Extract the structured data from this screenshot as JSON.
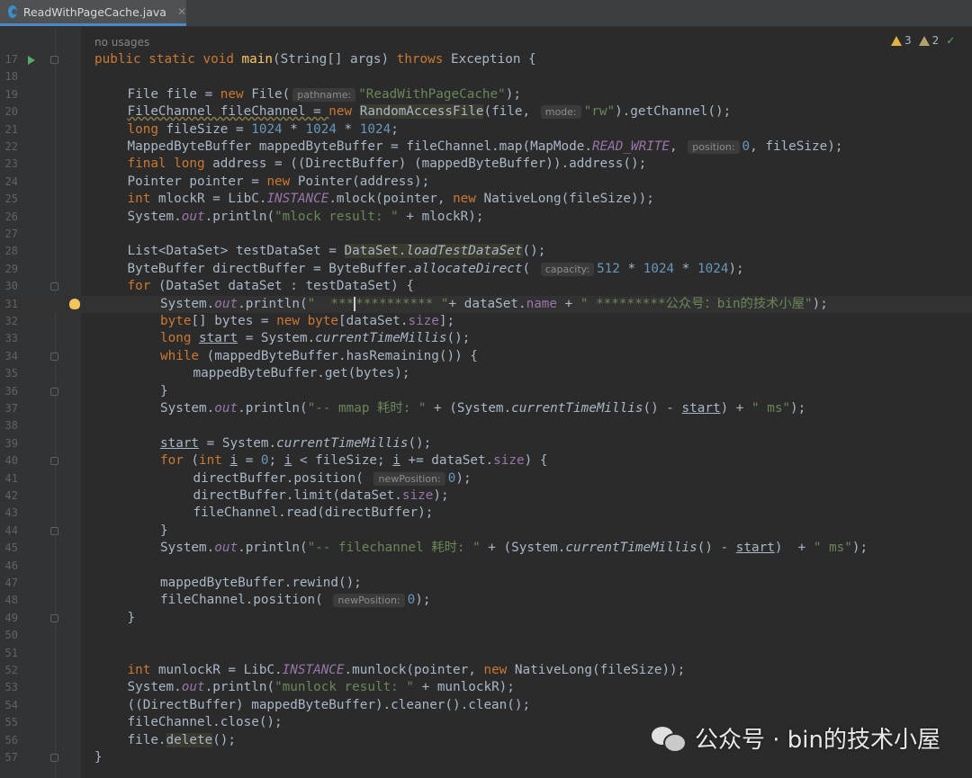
{
  "tab": {
    "filename": "ReadWithPageCache.java",
    "icon": "java-class-icon"
  },
  "no_usages": "no usages",
  "inspections": {
    "warnings": "3",
    "weak_warnings": "2",
    "ok_icon": "check-icon"
  },
  "lines": [
    {
      "n": "17"
    },
    {
      "n": "18"
    },
    {
      "n": "19"
    },
    {
      "n": "20"
    },
    {
      "n": "21"
    },
    {
      "n": "22"
    },
    {
      "n": "23"
    },
    {
      "n": "24"
    },
    {
      "n": "25"
    },
    {
      "n": "26"
    },
    {
      "n": "27"
    },
    {
      "n": "28"
    },
    {
      "n": "29"
    },
    {
      "n": "30"
    },
    {
      "n": "31"
    },
    {
      "n": "32"
    },
    {
      "n": "33"
    },
    {
      "n": "34"
    },
    {
      "n": "35"
    },
    {
      "n": "36"
    },
    {
      "n": "37"
    },
    {
      "n": "38"
    },
    {
      "n": "39"
    },
    {
      "n": "40"
    },
    {
      "n": "41"
    },
    {
      "n": "42"
    },
    {
      "n": "43"
    },
    {
      "n": "44"
    },
    {
      "n": "45"
    },
    {
      "n": "46"
    },
    {
      "n": "47"
    },
    {
      "n": "48"
    },
    {
      "n": "49"
    },
    {
      "n": "50"
    },
    {
      "n": "51"
    },
    {
      "n": "52"
    },
    {
      "n": "53"
    },
    {
      "n": "54"
    },
    {
      "n": "55"
    },
    {
      "n": "56"
    },
    {
      "n": "57"
    }
  ],
  "code": {
    "l17": [
      "public static void ",
      "main",
      "(String[] args) ",
      "throws",
      " Exception {"
    ],
    "l19": [
      "File file = ",
      "new",
      " File(",
      "pathname:",
      "\"ReadWithPageCache\"",
      ");"
    ],
    "l20": [
      "FileChannel fileChannel = ",
      "new",
      " ",
      "RandomAccessFile",
      "(file, ",
      "mode:",
      "\"rw\"",
      ").getChannel();"
    ],
    "l21": [
      "long",
      " fileSize = ",
      "1024",
      " * ",
      "1024",
      " * ",
      "1024",
      ";"
    ],
    "l22": [
      "MappedByteBuffer mappedByteBuffer = fileChannel.map(MapMode.",
      "READ_WRITE",
      ", ",
      "position:",
      "0",
      ", fileSize);"
    ],
    "l23": [
      "final long",
      " address = ((DirectBuffer) (mappedByteBuffer)).address();"
    ],
    "l24": [
      "Pointer pointer = ",
      "new",
      " Pointer(address);"
    ],
    "l25": [
      "int",
      " mlockR = LibC.",
      "INSTANCE",
      ".mlock(pointer, ",
      "new",
      " NativeLong(fileSize));"
    ],
    "l26": [
      "System.",
      "out",
      ".println(",
      "\"mlock result: \"",
      " + mlockR);"
    ],
    "l28": [
      "List<DataSet> testDataSet = ",
      "DataSet.",
      "loadTestDataSet",
      "();"
    ],
    "l29": [
      "ByteBuffer directBuffer = ByteBuffer.",
      "allocateDirect",
      "( ",
      "capacity:",
      "512",
      " * ",
      "1024",
      " * ",
      "1024",
      ");"
    ],
    "l30": [
      "for",
      " (DataSet dataSet : testDataSet) {"
    ],
    "l31": [
      "System.",
      "out",
      ".println(",
      "\"  ***",
      "**********",
      " \"",
      "+ dataSet.",
      "name",
      " + ",
      "\" *********公众号：bin的技术小屋\"",
      ");"
    ],
    "l32": [
      "byte",
      "[] bytes = ",
      "new",
      " ",
      "byte",
      "[dataSet.",
      "size",
      "];"
    ],
    "l33": [
      "long",
      " ",
      "start",
      " = System.",
      "currentTimeMillis",
      "();"
    ],
    "l34": [
      "while",
      " (mappedByteBuffer.hasRemaining()) {"
    ],
    "l35": [
      "mappedByteBuffer.get(bytes);"
    ],
    "l36": [
      "}"
    ],
    "l37": [
      "System.",
      "out",
      ".println(",
      "\"-- mmap 耗时: \"",
      " + (System.",
      "currentTimeMillis",
      "() - ",
      "start",
      ") + ",
      "\" ms\"",
      ");"
    ],
    "l39": [
      "start",
      " = System.",
      "currentTimeMillis",
      "();"
    ],
    "l40": [
      "for",
      " (",
      "int",
      " ",
      "i",
      " = ",
      "0",
      "; ",
      "i",
      " < fileSize; ",
      "i",
      " += dataSet.",
      "size",
      ") {"
    ],
    "l41": [
      "directBuffer.position( ",
      "newPosition:",
      "0",
      ");"
    ],
    "l42": [
      "directBuffer.limit(dataSet.",
      "size",
      ");"
    ],
    "l43": [
      "fileChannel.read(directBuffer);"
    ],
    "l44": [
      "}"
    ],
    "l45": [
      "System.",
      "out",
      ".println(",
      "\"-- filechannel 耗时: \"",
      " + (System.",
      "currentTimeMillis",
      "() - ",
      "start",
      ")  + ",
      "\" ms\"",
      ");"
    ],
    "l47": [
      "mappedByteBuffer.rewind();"
    ],
    "l48": [
      "fileChannel.position( ",
      "newPosition:",
      "0",
      ");"
    ],
    "l49": [
      "}"
    ],
    "l52": [
      "int",
      " munlockR = LibC.",
      "INSTANCE",
      ".munlock(pointer, ",
      "new",
      " NativeLong(fileSize));"
    ],
    "l53": [
      "System.",
      "out",
      ".println(",
      "\"munlock result: \"",
      " + munlockR);"
    ],
    "l54": [
      "((DirectBuffer) mappedByteBuffer).cleaner().clean();"
    ],
    "l55": [
      "fileChannel.close();"
    ],
    "l56": [
      "file.",
      "delete",
      "();"
    ],
    "l57": [
      "}"
    ]
  },
  "watermark": {
    "text": "公众号 · bin的技术小屋",
    "icon": "wechat-icon"
  }
}
